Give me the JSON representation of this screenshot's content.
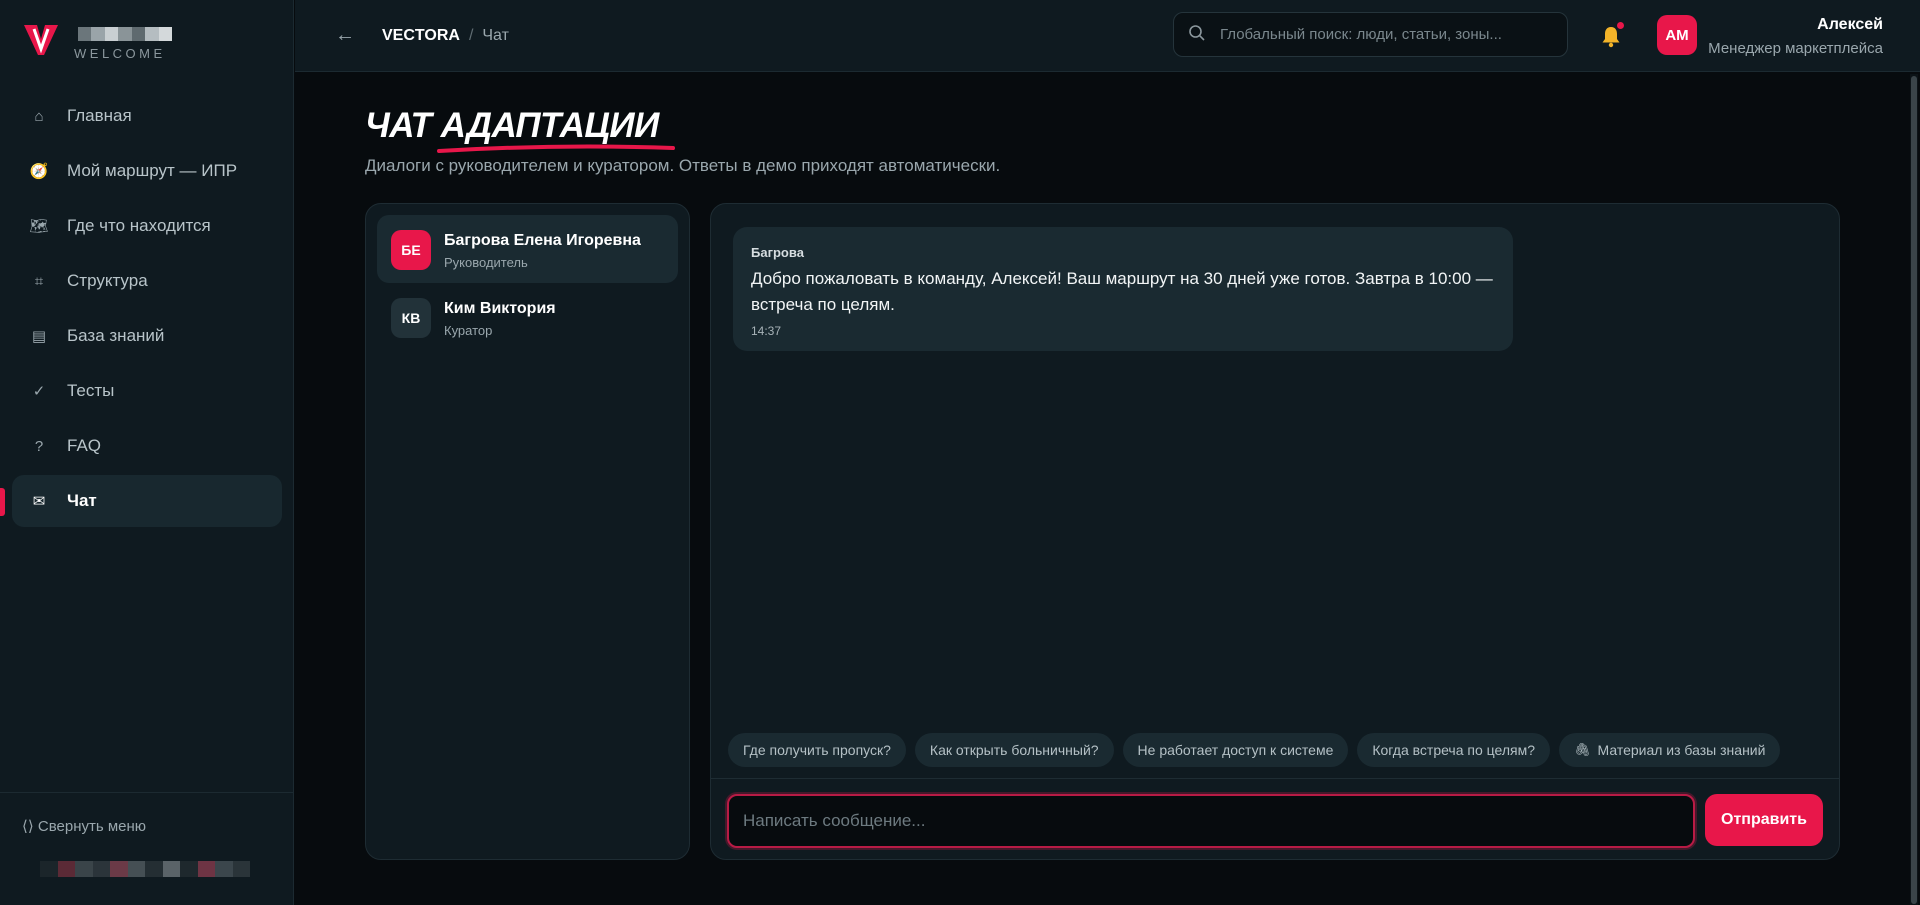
{
  "brand": {
    "logo_word": "WELCOME",
    "accent": "#e8174a",
    "pixel_colors": [
      "#6b767b",
      "#9aa4a9",
      "#c9cfd2",
      "#8a9498",
      "#5f6a6f",
      "#b5bdc1",
      "#d4d9db"
    ]
  },
  "sidebar": {
    "items": [
      {
        "label": "Главная",
        "icon": "home-icon",
        "glyph": "⌂"
      },
      {
        "label": "Мой маршрут — ИПР",
        "icon": "compass-icon",
        "glyph": "🧭"
      },
      {
        "label": "Где что находится",
        "icon": "map-icon",
        "glyph": "🗺"
      },
      {
        "label": "Структура",
        "icon": "grid-icon",
        "glyph": "⌗"
      },
      {
        "label": "База знаний",
        "icon": "book-icon",
        "glyph": "▤"
      },
      {
        "label": "Тесты",
        "icon": "check-icon",
        "glyph": "✓"
      },
      {
        "label": "FAQ",
        "icon": "question-icon",
        "glyph": "?"
      },
      {
        "label": "Чат",
        "icon": "mail-icon",
        "glyph": "✉"
      }
    ],
    "collapse_label": "⟨⟩ Свернуть меню",
    "blurred_colors": [
      "#1b252a",
      "#5b2a36",
      "#3a4449",
      "#2b343a",
      "#6b3a47",
      "#454f54",
      "#242e33",
      "#5a6368",
      "#1e282d",
      "#6e3444",
      "#3b464c",
      "#2a3439"
    ]
  },
  "header": {
    "back_glyph": "←",
    "breadcrumb_root": "VECTORA",
    "breadcrumb_sep": "/",
    "breadcrumb_current": "Чат",
    "search_placeholder": "Глобальный поиск: люди, статьи, зоны...",
    "user": {
      "initials": "АМ",
      "name": "Алексей",
      "role": "Менеджер маркетплейса"
    }
  },
  "page": {
    "title_a": "ЧАТ ",
    "title_b": "АДАПТАЦИИ",
    "subtitle": "Диалоги с руководителем и куратором. Ответы в демо приходят автоматически."
  },
  "contacts": [
    {
      "initials": "БЕ",
      "name": "Багрова Елена Игоревна",
      "role": "Руководитель",
      "avatar_color": "#e8174a"
    },
    {
      "initials": "КВ",
      "name": "Ким Виктория",
      "role": "Куратор",
      "avatar_color": "#223239"
    }
  ],
  "chat": {
    "messages": [
      {
        "author": "Багрова",
        "text": "Добро пожаловать в команду, Алексей! Ваш маршрут на 30 дней уже готов. Завтра в 10:00 — встреча по целям.",
        "time": "14:37"
      }
    ],
    "quick_replies": [
      "Где получить пропуск?",
      "Как открыть больничный?",
      "Не работает доступ к системе",
      "Когда встреча по целям?"
    ],
    "kb_chip_icon": "paperclip-icon",
    "kb_chip_label": "Материал из базы знаний",
    "input_placeholder": "Написать сообщение...",
    "send_label": "Отправить"
  }
}
